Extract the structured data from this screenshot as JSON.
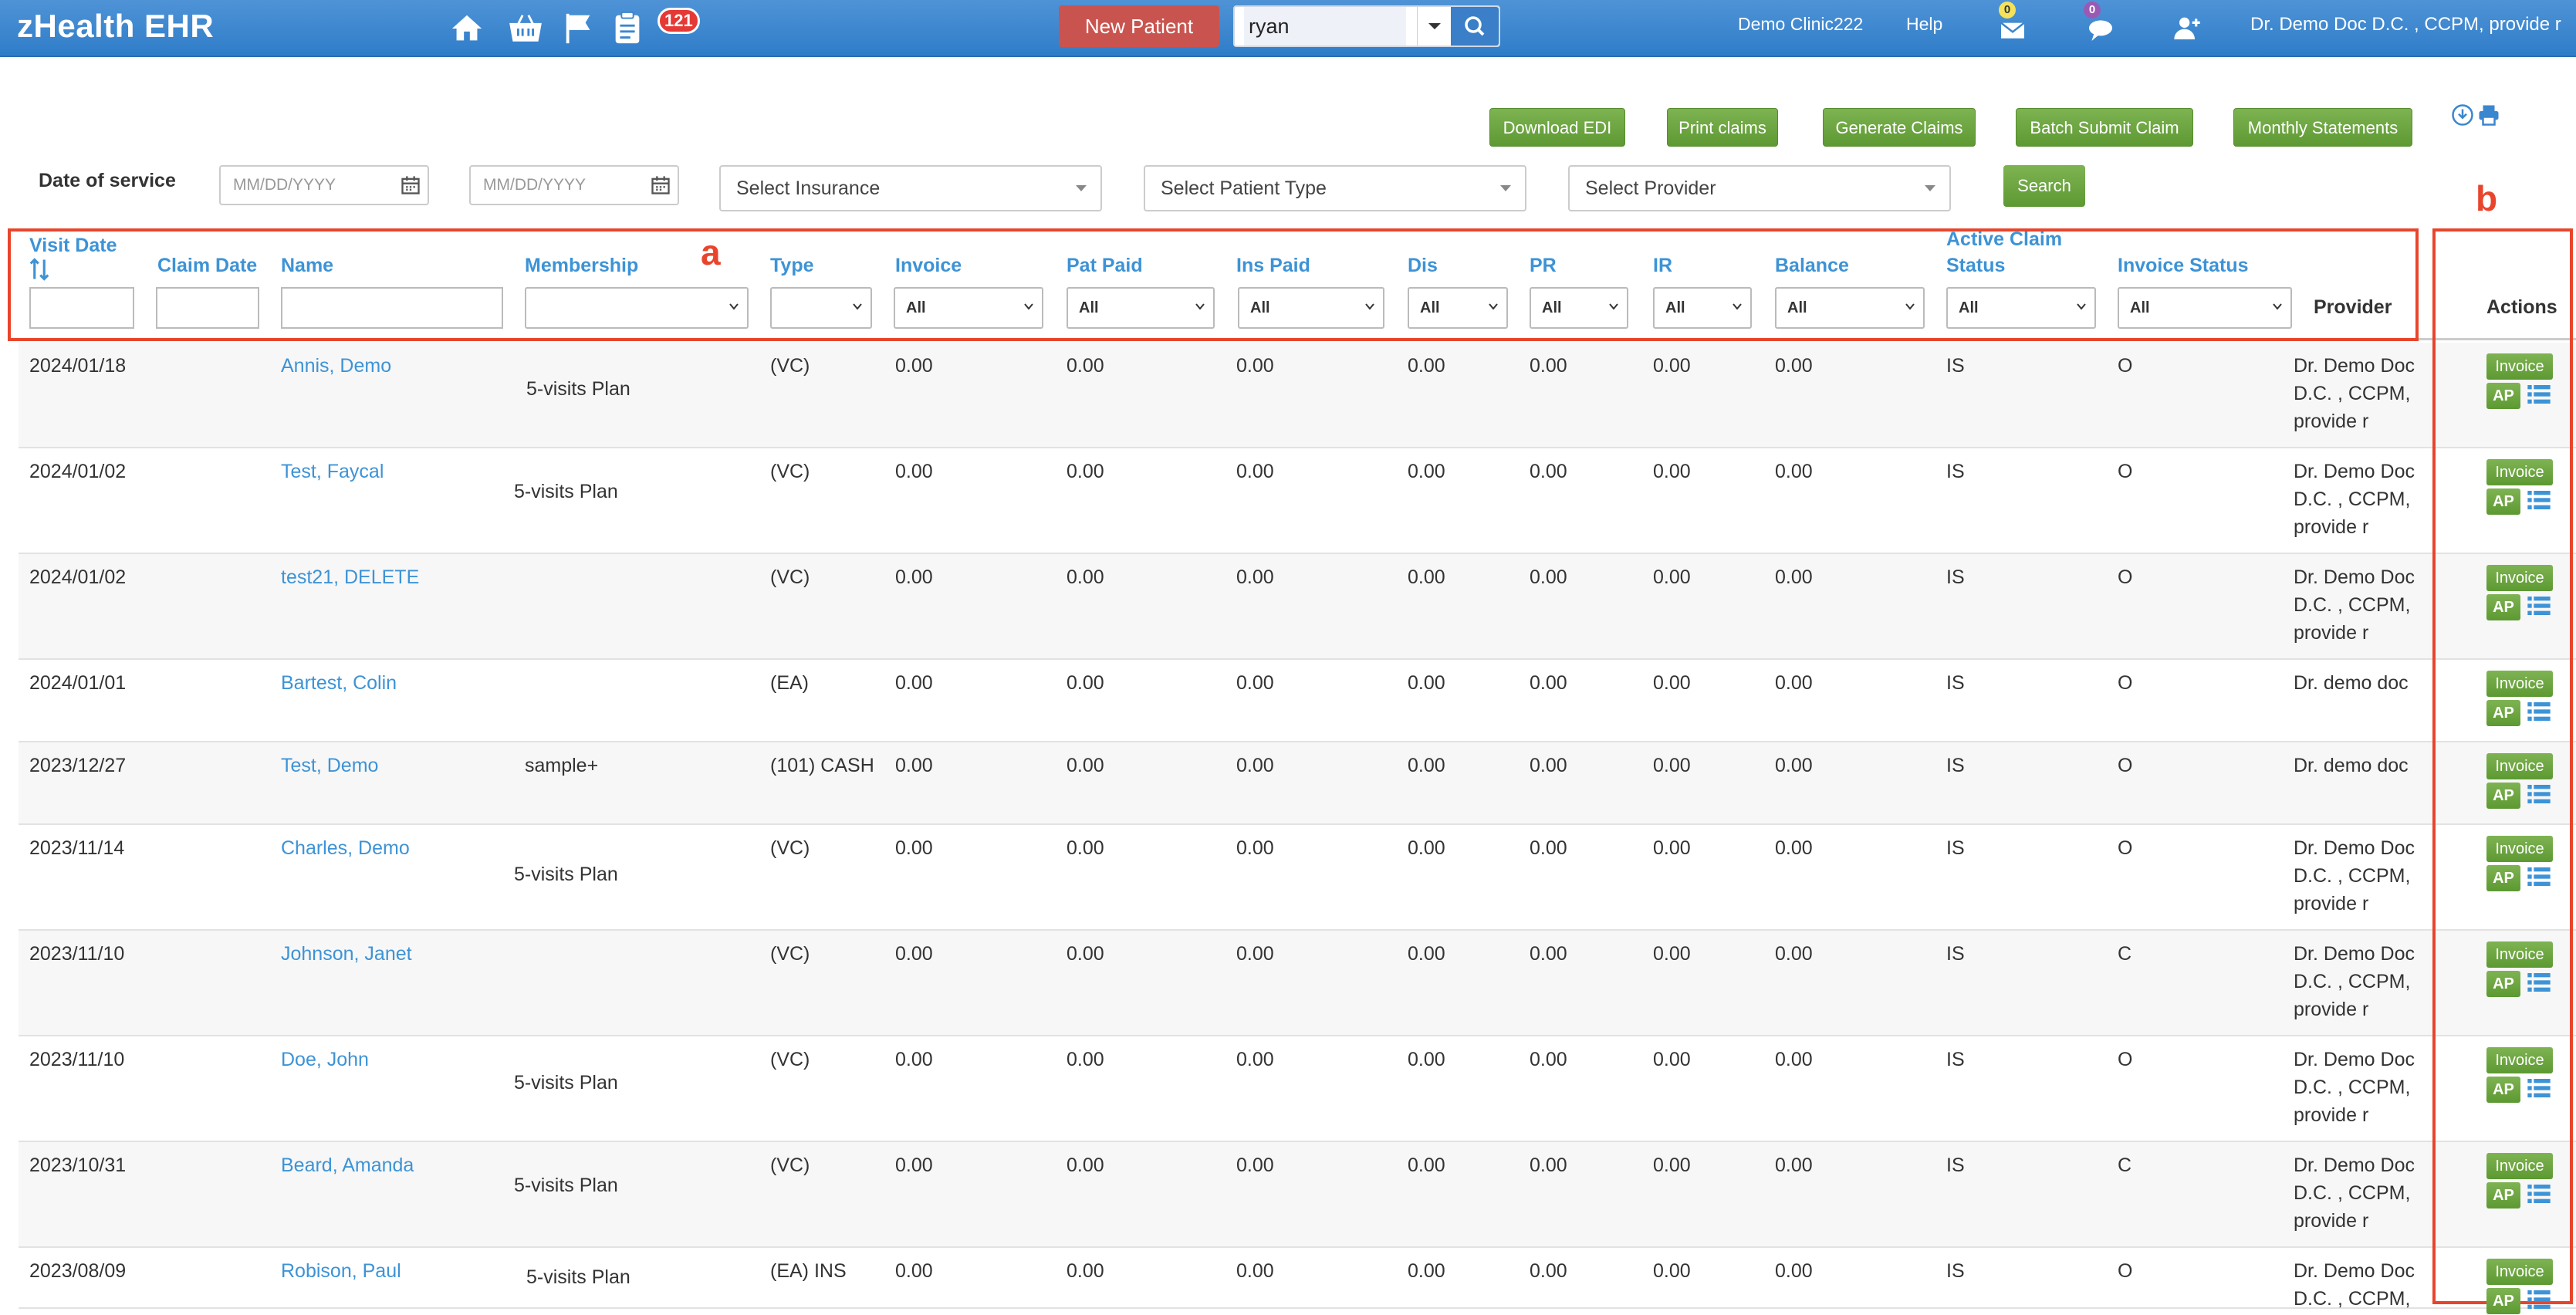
{
  "navbar": {
    "brand": "zHealth EHR",
    "notification_count": "121",
    "new_patient_label": "New Patient",
    "search_value": "ryan",
    "clinic": "Demo Clinic222",
    "help": "Help",
    "mail_badge": "0",
    "chat_badge": "0",
    "user": "Dr. Demo Doc D.C. , CCPM, provide r",
    "icons": [
      "home-icon",
      "basket-icon",
      "flag-icon",
      "clipboard-icon",
      "envelope-icon",
      "chat-icon",
      "add-user-icon",
      "search-icon",
      "download-icon",
      "print-icon"
    ]
  },
  "toolbar": {
    "download_edi": "Download EDI",
    "print_claims": "Print claims",
    "generate_claims": "Generate Claims",
    "batch_submit": "Batch Submit Claim",
    "monthly_statements": "Monthly Statements"
  },
  "filters": {
    "date_label": "Date of service",
    "date_from_placeholder": "MM/DD/YYYY",
    "date_to_placeholder": "MM/DD/YYYY",
    "insurance": "Select Insurance",
    "patient_type": "Select Patient Type",
    "provider": "Select Provider",
    "search_label": "Search"
  },
  "table": {
    "headers": {
      "visit_date": "Visit Date",
      "claim_date": "Claim Date",
      "name": "Name",
      "membership": "Membership",
      "type": "Type",
      "invoice": "Invoice",
      "pat_paid": "Pat Paid",
      "ins_paid": "Ins Paid",
      "dis": "Dis",
      "pr": "PR",
      "ir": "IR",
      "balance": "Balance",
      "active_claim_status_1": "Active Claim",
      "active_claim_status_2": "Status",
      "invoice_status": "Invoice Status",
      "provider": "Provider",
      "actions": "Actions"
    },
    "filter_all": "All",
    "rows": [
      {
        "visit_date": "2024/01/18",
        "name": "Annis, Demo",
        "membership": "5-visits Plan",
        "type": "(VC)",
        "invoice": "0.00",
        "pat_paid": "0.00",
        "ins_paid": "0.00",
        "dis": "0.00",
        "pr": "0.00",
        "ir": "0.00",
        "balance": "0.00",
        "claim_status": "IS",
        "invoice_status": "O",
        "provider_1": "Dr. Demo Doc",
        "provider_2": "D.C. , CCPM,",
        "provider_3": "provide r"
      },
      {
        "visit_date": "2024/01/02",
        "name": "Test, Faycal",
        "membership": "5-visits Plan",
        "type": "(VC)",
        "invoice": "0.00",
        "pat_paid": "0.00",
        "ins_paid": "0.00",
        "dis": "0.00",
        "pr": "0.00",
        "ir": "0.00",
        "balance": "0.00",
        "claim_status": "IS",
        "invoice_status": "O",
        "provider_1": "Dr. Demo Doc",
        "provider_2": "D.C. , CCPM,",
        "provider_3": "provide r"
      },
      {
        "visit_date": "2024/01/02",
        "name": "test21, DELETE",
        "membership": "",
        "type": "(VC)",
        "invoice": "0.00",
        "pat_paid": "0.00",
        "ins_paid": "0.00",
        "dis": "0.00",
        "pr": "0.00",
        "ir": "0.00",
        "balance": "0.00",
        "claim_status": "IS",
        "invoice_status": "O",
        "provider_1": "Dr. Demo Doc",
        "provider_2": "D.C. , CCPM,",
        "provider_3": "provide r"
      },
      {
        "visit_date": "2024/01/01",
        "name": "Bartest, Colin",
        "membership": "",
        "type": "(EA)",
        "invoice": "0.00",
        "pat_paid": "0.00",
        "ins_paid": "0.00",
        "dis": "0.00",
        "pr": "0.00",
        "ir": "0.00",
        "balance": "0.00",
        "claim_status": "IS",
        "invoice_status": "O",
        "provider_1": "Dr. demo doc",
        "provider_2": "",
        "provider_3": ""
      },
      {
        "visit_date": "2023/12/27",
        "name": "Test, Demo",
        "membership": "sample+",
        "type": "(101) CASH",
        "invoice": "0.00",
        "pat_paid": "0.00",
        "ins_paid": "0.00",
        "dis": "0.00",
        "pr": "0.00",
        "ir": "0.00",
        "balance": "0.00",
        "claim_status": "IS",
        "invoice_status": "O",
        "provider_1": "Dr. demo doc",
        "provider_2": "",
        "provider_3": ""
      },
      {
        "visit_date": "2023/11/14",
        "name": "Charles, Demo",
        "membership": "5-visits Plan",
        "type": "(VC)",
        "invoice": "0.00",
        "pat_paid": "0.00",
        "ins_paid": "0.00",
        "dis": "0.00",
        "pr": "0.00",
        "ir": "0.00",
        "balance": "0.00",
        "claim_status": "IS",
        "invoice_status": "O",
        "provider_1": "Dr. Demo Doc",
        "provider_2": "D.C. , CCPM,",
        "provider_3": "provide r"
      },
      {
        "visit_date": "2023/11/10",
        "name": "Johnson, Janet",
        "membership": "",
        "type": "(VC)",
        "invoice": "0.00",
        "pat_paid": "0.00",
        "ins_paid": "0.00",
        "dis": "0.00",
        "pr": "0.00",
        "ir": "0.00",
        "balance": "0.00",
        "claim_status": "IS",
        "invoice_status": "C",
        "provider_1": "Dr. Demo Doc",
        "provider_2": "D.C. , CCPM,",
        "provider_3": "provide r"
      },
      {
        "visit_date": "2023/11/10",
        "name": "Doe, John",
        "membership": "5-visits Plan",
        "type": "(VC)",
        "invoice": "0.00",
        "pat_paid": "0.00",
        "ins_paid": "0.00",
        "dis": "0.00",
        "pr": "0.00",
        "ir": "0.00",
        "balance": "0.00",
        "claim_status": "IS",
        "invoice_status": "O",
        "provider_1": "Dr. Demo Doc",
        "provider_2": "D.C. , CCPM,",
        "provider_3": "provide r"
      },
      {
        "visit_date": "2023/10/31",
        "name": "Beard, Amanda",
        "membership": "5-visits Plan",
        "type": "(VC)",
        "invoice": "0.00",
        "pat_paid": "0.00",
        "ins_paid": "0.00",
        "dis": "0.00",
        "pr": "0.00",
        "ir": "0.00",
        "balance": "0.00",
        "claim_status": "IS",
        "invoice_status": "C",
        "provider_1": "Dr. Demo Doc",
        "provider_2": "D.C. , CCPM,",
        "provider_3": "provide r"
      },
      {
        "visit_date": "2023/08/09",
        "name": "Robison, Paul",
        "membership": "5-visits Plan",
        "type": "(EA) INS",
        "invoice": "0.00",
        "pat_paid": "0.00",
        "ins_paid": "0.00",
        "dis": "0.00",
        "pr": "0.00",
        "ir": "0.00",
        "balance": "0.00",
        "claim_status": "IS",
        "invoice_status": "O",
        "provider_1": "Dr. Demo Doc",
        "provider_2": "D.C. , CCPM,",
        "provider_3": ""
      }
    ],
    "action_invoice": "Invoice",
    "action_ap": "AP"
  },
  "annotations": {
    "a": "a",
    "b": "b",
    "color": "#e8452c"
  },
  "colors": {
    "navbar": "#3a86cf",
    "link": "#3d93d6",
    "green_button": "#6aa43d",
    "new_patient": "#c9544f"
  }
}
